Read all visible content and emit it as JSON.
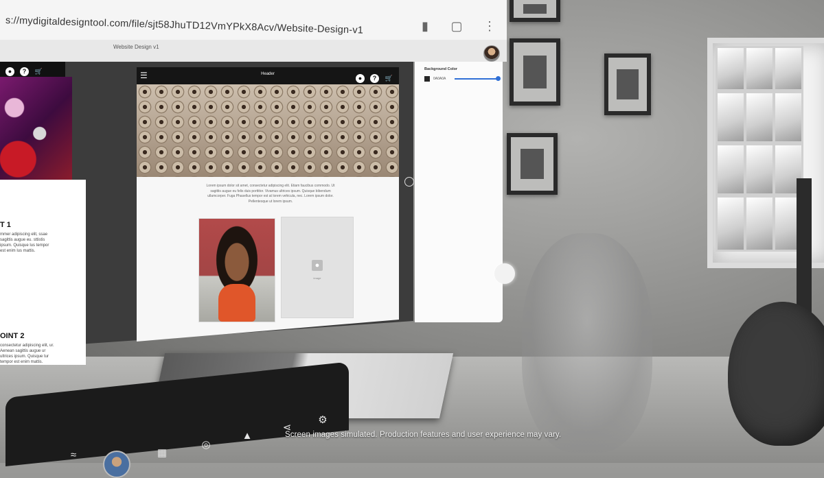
{
  "browser": {
    "url": "s://mydigitaldesigntool.com/file/sjt58JhuTD12VmYPkX8Acv/Website-Design-v1",
    "icons": {
      "bookmark": "bookmark-icon",
      "display": "monitor-icon",
      "menu": "more-vert-icon"
    }
  },
  "app": {
    "title": "Website Design v1"
  },
  "left_preview": {
    "section1_heading": "T 1",
    "section1_body": "mmer adipiscing elit, ssae sagittis augue eu. sttistis ipsum. Quisque lus tempor est enim lus mattis.",
    "section2_heading": "OINT 2",
    "section2_body": "consectetur adipiscing elit, ur. Aenean sagittis augue ur ultrices ipsum. Quisque tur tempor est enim mattis."
  },
  "main_preview": {
    "header_title": "Header",
    "lorem": "Lorem ipsum dolor sit amet, consectetur adipiscing elit. Etiam faucibus commodo. Ut sagittis augue eu felis duis porttitor. Vivamus ultrices ipsum. Quisque bibendum ullamcorper. Fuga Phasellus tempor est at lorem vehicula, nec. Lorem ipsum dolor. Pellentesque ut lorem ipsum.",
    "placeholder_label": "image"
  },
  "properties": {
    "label": "Background Color",
    "hex": "0A0A0A",
    "swatch_color": "#262626",
    "slider_value": 0.95
  },
  "dock": {
    "items": [
      "wifi-icon",
      "avatar",
      "apps-grid-icon",
      "messenger-icon",
      "notifications-icon",
      "share-icon",
      "settings-icon"
    ]
  },
  "disclaimer": "Screen images simulated. Production features and user experience may vary."
}
